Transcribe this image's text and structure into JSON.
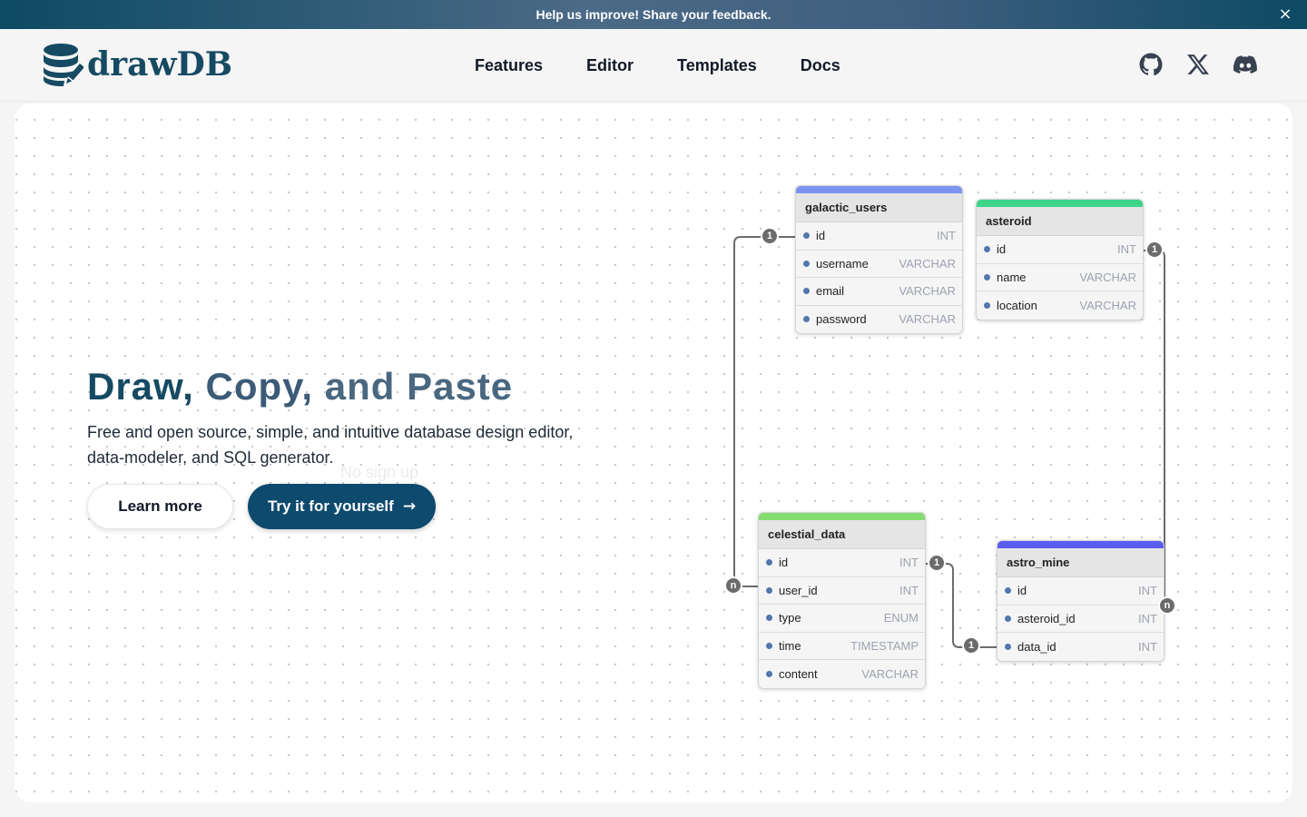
{
  "banner": {
    "text": "Help us improve! Share your feedback.",
    "close_icon": "×"
  },
  "brand": {
    "name": "drawDB",
    "color": "#164a63"
  },
  "nav": {
    "links": [
      "Features",
      "Editor",
      "Templates",
      "Docs"
    ],
    "social_icons": [
      "github-icon",
      "x-twitter-icon",
      "discord-icon"
    ]
  },
  "hero": {
    "title_parts": [
      "Draw,",
      "Copy,",
      "and Paste"
    ],
    "subtitle": "Free and open source, simple, and intuitive database design editor, data-modeler, and SQL generator.",
    "faded_hint": "No sign up",
    "learn_more": "Learn more",
    "try_label": "Try it for yourself",
    "try_arrow": "→"
  },
  "tables": [
    {
      "name": "galactic_users",
      "color": "#7c93f0",
      "fields": [
        {
          "name": "id",
          "type": "INT"
        },
        {
          "name": "username",
          "type": "VARCHAR"
        },
        {
          "name": "email",
          "type": "VARCHAR"
        },
        {
          "name": "password",
          "type": "VARCHAR"
        }
      ]
    },
    {
      "name": "asteroid",
      "color": "#3ed48a",
      "fields": [
        {
          "name": "id",
          "type": "INT"
        },
        {
          "name": "name",
          "type": "VARCHAR"
        },
        {
          "name": "location",
          "type": "VARCHAR"
        }
      ]
    },
    {
      "name": "celestial_data",
      "color": "#85dc6f",
      "fields": [
        {
          "name": "id",
          "type": "INT"
        },
        {
          "name": "user_id",
          "type": "INT"
        },
        {
          "name": "type",
          "type": "ENUM"
        },
        {
          "name": "time",
          "type": "TIMESTAMP"
        },
        {
          "name": "content",
          "type": "VARCHAR"
        }
      ]
    },
    {
      "name": "astro_mine",
      "color": "#5b5cf0",
      "fields": [
        {
          "name": "id",
          "type": "INT"
        },
        {
          "name": "asteroid_id",
          "type": "INT"
        },
        {
          "name": "data_id",
          "type": "INT"
        }
      ]
    }
  ],
  "relationships": {
    "users_to_data": [
      "1",
      "n"
    ],
    "asteroid_to_mine": [
      "1",
      "n"
    ],
    "data_to_mine": [
      "1",
      "1"
    ]
  }
}
